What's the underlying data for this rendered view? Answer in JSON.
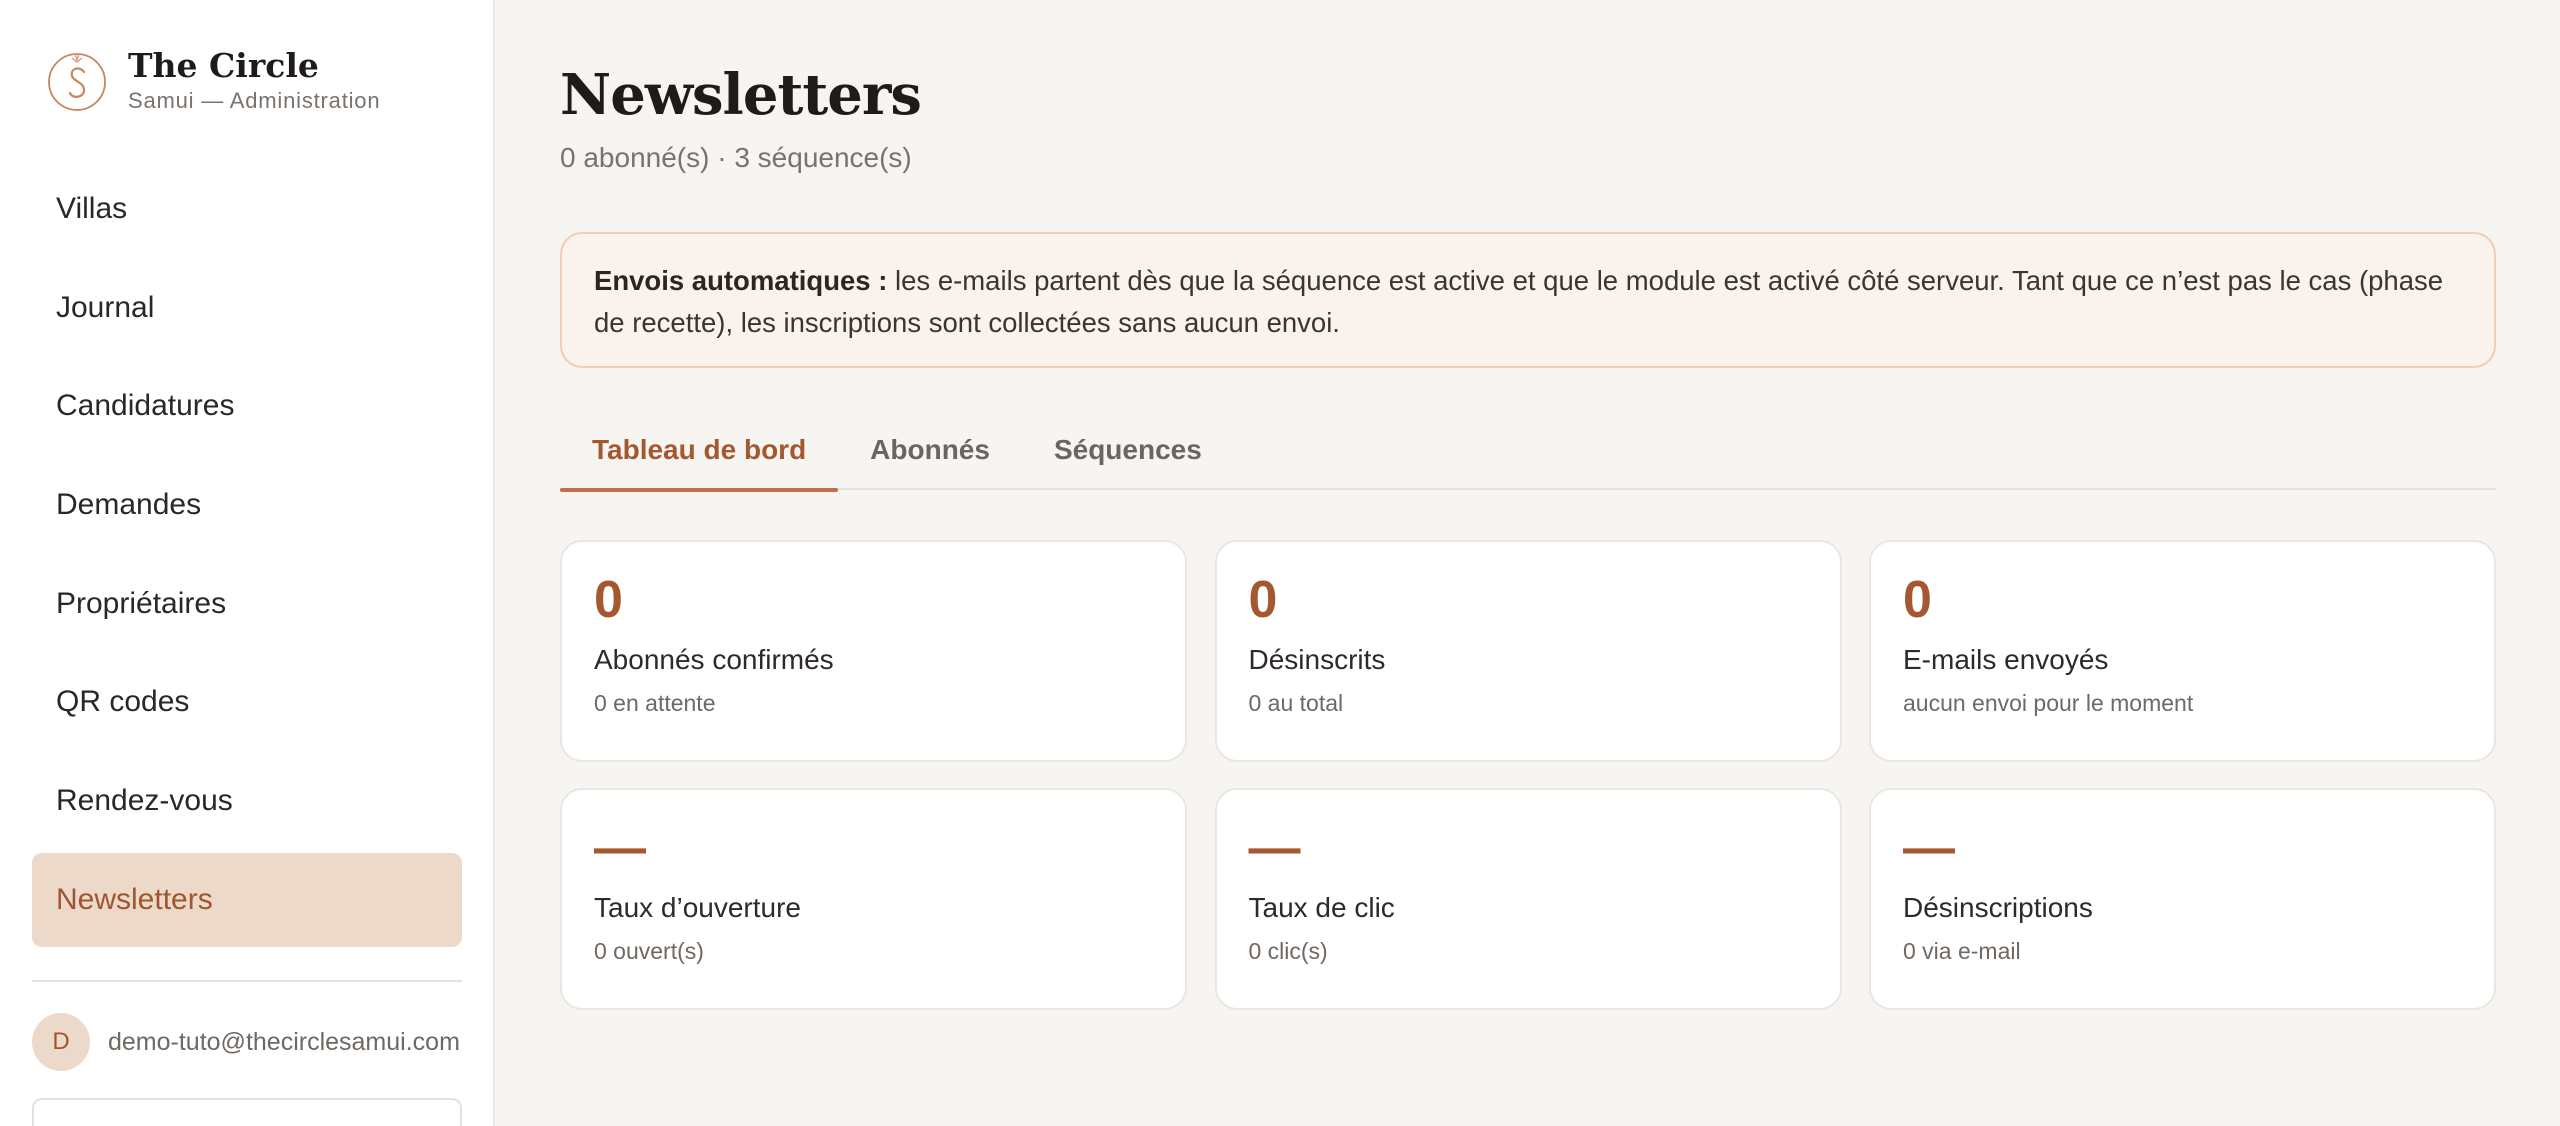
{
  "brand": {
    "title": "The Circle",
    "subtitle": "Samui — Administration",
    "logo_icon": "monogram-s-logo"
  },
  "sidebar": {
    "items": [
      {
        "label": "Villas",
        "active": false
      },
      {
        "label": "Journal",
        "active": false
      },
      {
        "label": "Candidatures",
        "active": false
      },
      {
        "label": "Demandes",
        "active": false
      },
      {
        "label": "Propriétaires",
        "active": false
      },
      {
        "label": "QR codes",
        "active": false
      },
      {
        "label": "Rendez-vous",
        "active": false
      },
      {
        "label": "Newsletters",
        "active": true
      }
    ],
    "user": {
      "initial": "D",
      "email": "demo-tuto@thecirclesamui.com"
    }
  },
  "main": {
    "title": "Newsletters",
    "subtitle": "0 abonné(s) · 3 séquence(s)",
    "notice": {
      "strong": "Envois automatiques :",
      "text": " les e-mails partent dès que la séquence est active et que le module est activé côté serveur. Tant que ce n’est pas le cas (phase de recette), les inscriptions sont collectées sans aucun envoi."
    },
    "tabs": [
      {
        "label": "Tableau de bord",
        "active": true
      },
      {
        "label": "Abonnés",
        "active": false
      },
      {
        "label": "Séquences",
        "active": false
      }
    ],
    "cards": [
      {
        "value": "0",
        "label": "Abonnés confirmés",
        "sub": "0 en attente"
      },
      {
        "value": "0",
        "label": "Désinscrits",
        "sub": "0 au total"
      },
      {
        "value": "0",
        "label": "E-mails envoyés",
        "sub": "aucun envoi pour le moment"
      },
      {
        "value": "—",
        "label": "Taux d’ouverture",
        "sub": "0 ouvert(s)"
      },
      {
        "value": "—",
        "label": "Taux de clic",
        "sub": "0 clic(s)"
      },
      {
        "value": "—",
        "label": "Désinscriptions",
        "sub": "0 via e-mail"
      }
    ]
  },
  "colors": {
    "accent": "#a5582f",
    "active_nav_bg": "#ecd9ca",
    "notice_bg": "#faf2ec",
    "notice_border": "#f1cdb6"
  }
}
